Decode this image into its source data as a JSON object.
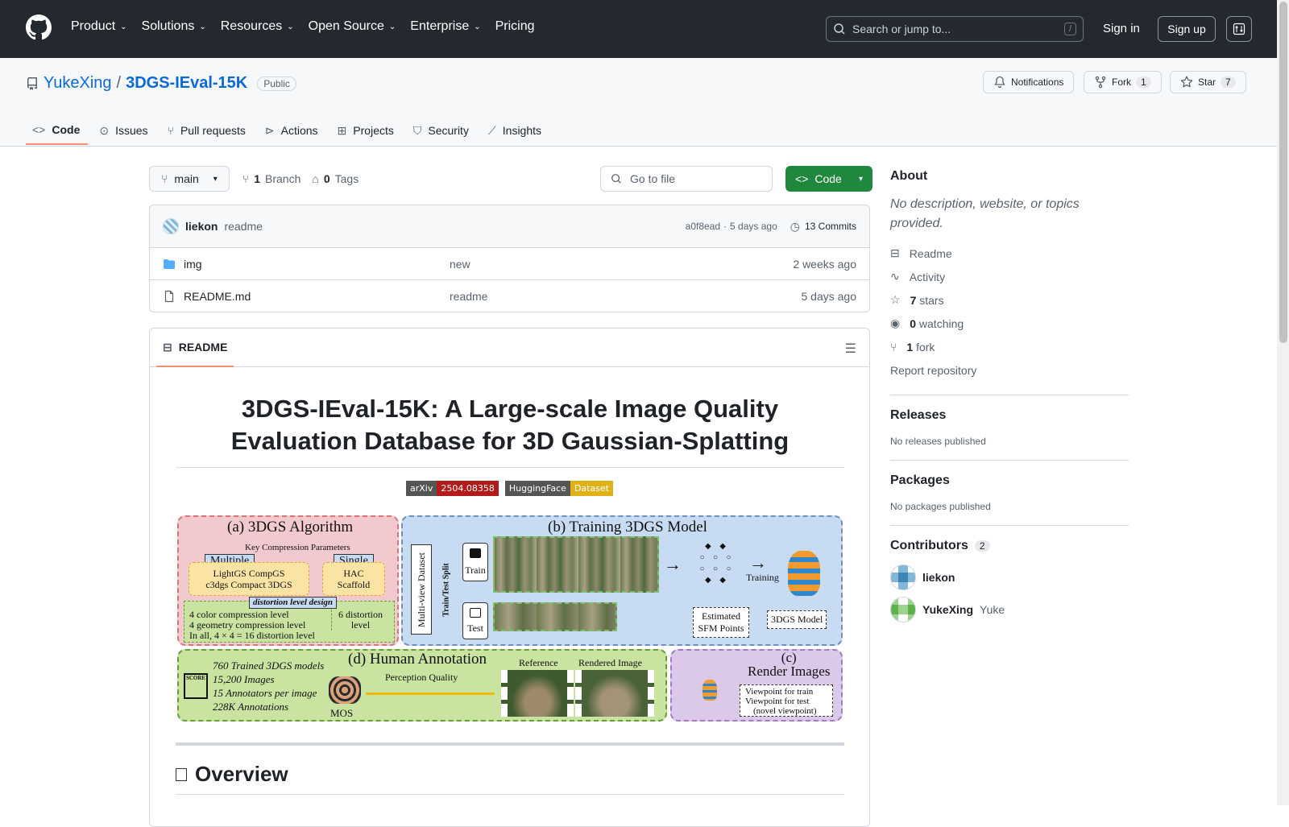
{
  "nav": {
    "items": [
      "Product",
      "Solutions",
      "Resources",
      "Open Source",
      "Enterprise",
      "Pricing"
    ],
    "search_placeholder": "Search or jump to...",
    "search_kbd": "/",
    "signin": "Sign in",
    "signup": "Sign up"
  },
  "repo": {
    "owner": "YukeXing",
    "sep": "/",
    "name": "3DGS-IEval-15K",
    "visibility": "Public",
    "notifications": "Notifications",
    "fork": "Fork",
    "fork_count": "1",
    "star": "Star",
    "star_count": "7"
  },
  "tabs": [
    "Code",
    "Issues",
    "Pull requests",
    "Actions",
    "Projects",
    "Security",
    "Insights"
  ],
  "toolbar": {
    "branch": "main",
    "branches_count": "1",
    "branches_label": "Branch",
    "tags_count": "0",
    "tags_label": "Tags",
    "goto": "Go to file",
    "code": "Code"
  },
  "commit": {
    "author": "liekon",
    "message": "readme",
    "hash": "a0f8ead",
    "dot": "·",
    "time": "5 days ago",
    "commits": "13 Commits"
  },
  "files": [
    {
      "name": "img",
      "msg": "new",
      "time": "2 weeks ago",
      "type": "folder"
    },
    {
      "name": "README.md",
      "msg": "readme",
      "time": "5 days ago",
      "type": "file"
    }
  ],
  "readme": {
    "tab": "README",
    "title_line1": "3DGS-IEval-15K: A Large-scale Image Quality",
    "title_line2": "Evaluation Database for 3D Gaussian-Splatting",
    "badge1_left": "arXiv",
    "badge1_right": "2504.08358",
    "badge2_left": "HuggingFace",
    "badge2_right": "Dataset",
    "overview": "Overview",
    "fig": {
      "a_title": "(a) 3DGS Algorithm",
      "a_sub": "Key Compression Parameters",
      "a_multi": "Multiple",
      "a_single": "Single",
      "a_m1": "LightGS   CompGS",
      "a_m2": "c3dgs   Compact 3DGS",
      "a_s1": "HAC",
      "a_s2": "Scaffold",
      "a_dist": "distortion level design",
      "a_l1": "4 color compression level",
      "a_l2": "4 geometry compression level",
      "a_l3": "In all, 4 × 4 = 16 distortion level",
      "a_l4": "6 distortion",
      "a_l5": "level",
      "b_title": "(b) Training 3DGS Model",
      "b_mv": "Multi-view Dataset",
      "b_split": "Train/Test Split",
      "b_train": "Train",
      "b_test": "Test",
      "b_training": "Training",
      "b_sfm1": "Estimated",
      "b_sfm2": "SFM Points",
      "b_model": "3DGS Model",
      "d_title": "(d) Human Annotation",
      "d_l1": "760 Trained 3DGS models",
      "d_l2": "15,200 Images",
      "d_l3": "15 Annotators per image",
      "d_l4": "228K Annotations",
      "d_score": "SCORE",
      "d_mos": "MOS",
      "d_pq": "Perception Quality",
      "d_ref": "Reference",
      "d_rend": "Rendered Image",
      "c_title": "(c)",
      "c_title2": "Render Images",
      "c_l1": "Viewpoint for train",
      "c_l2": "Viewpoint for test",
      "c_l3": "(novel viewpoint)"
    }
  },
  "about": {
    "title": "About",
    "desc": "No description, website, or topics provided.",
    "readme": "Readme",
    "activity": "Activity",
    "stars_n": "7",
    "stars": "stars",
    "watch_n": "0",
    "watch": "watching",
    "fork_n": "1",
    "fork": "fork",
    "report": "Report repository"
  },
  "releases": {
    "title": "Releases",
    "text": "No releases published"
  },
  "packages": {
    "title": "Packages",
    "text": "No packages published"
  },
  "contributors": {
    "title": "Contributors",
    "count": "2",
    "list": [
      {
        "login": "liekon",
        "name": ""
      },
      {
        "login": "YukeXing",
        "name": "Yuke"
      }
    ]
  },
  "colors": {
    "accent": "#0969da",
    "header": "#24292f",
    "green": "#1f883d"
  }
}
